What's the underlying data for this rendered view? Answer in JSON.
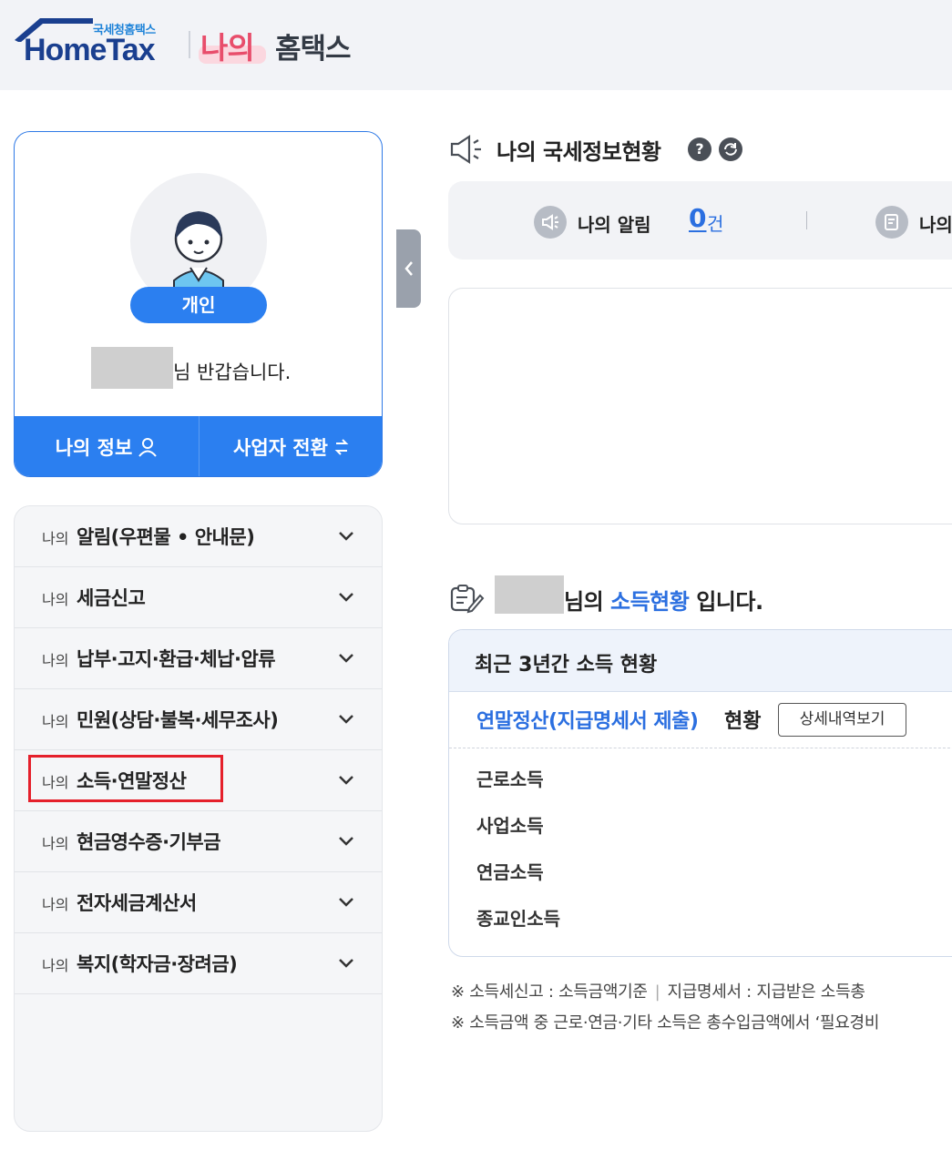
{
  "header": {
    "logo_sub": "국세청홈택스",
    "logo_main": "HomeTax",
    "title_highlight": "나의",
    "title_rest": "홈택스"
  },
  "profile": {
    "badge": "개인",
    "greeting": "님 반갑습니다.",
    "my_info_button": "나의 정보",
    "switch_business_button": "사업자 전환"
  },
  "sidebar": {
    "items": [
      {
        "prefix": "나의",
        "label": "알림(우편물 • 안내문)"
      },
      {
        "prefix": "나의",
        "label": "세금신고"
      },
      {
        "prefix": "나의",
        "label": "납부·고지·환급·체납·압류"
      },
      {
        "prefix": "나의",
        "label": "민원(상담·불복·세무조사)"
      },
      {
        "prefix": "나의",
        "label": "소득·연말정산"
      },
      {
        "prefix": "나의",
        "label": "현금영수증·기부금"
      },
      {
        "prefix": "나의",
        "label": "전자세금계산서"
      },
      {
        "prefix": "나의",
        "label": "복지(학자금·장려금)"
      }
    ]
  },
  "status": {
    "title": "나의 국세정보현황",
    "help_symbol": "?",
    "notice_label": "나의 알림",
    "notice_count": "0",
    "notice_unit": "건",
    "second_label": "나의"
  },
  "income": {
    "heading_prefix": "님의 ",
    "heading_highlight": "소득현황",
    "heading_suffix": " 입니다.",
    "box_title": "최근 3년간 소득 현황",
    "year_end_label": "연말정산(지급명세서 제출)",
    "year_end_suffix": "현황",
    "detail_button": "상세내역보기",
    "rows": [
      "근로소득",
      "사업소득",
      "연금소득",
      "종교인소득"
    ]
  },
  "notes": {
    "line1_a": "※ 소득세신고 : 소득금액기준",
    "line1_sep": "|",
    "line1_b": "지급명세서 : 지급받은 소득총",
    "line2": "※ 소득금액 중 근로·연금·기타 소득은 총수입금액에서 ‘필요경비"
  }
}
